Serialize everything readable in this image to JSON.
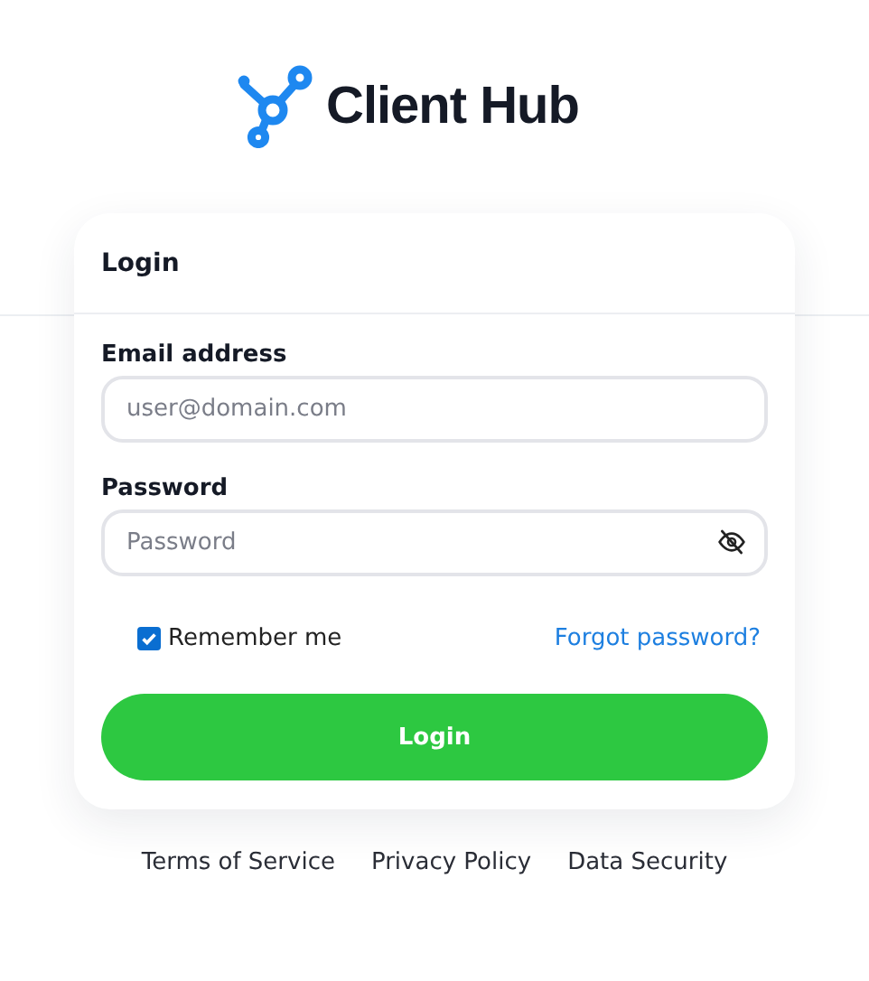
{
  "brand": {
    "name": "Client Hub"
  },
  "card": {
    "title": "Login",
    "fields": [
      {
        "label": "Email address",
        "placeholder": "user@domain.com",
        "kind": "text"
      },
      {
        "label": "Password",
        "placeholder": "Password",
        "kind": "password"
      }
    ],
    "remember": {
      "label": "Remember me",
      "checked": true
    },
    "forgot_link": "Forgot password?",
    "submit": "Login"
  },
  "footer_links": [
    "Terms of Service",
    "Privacy Policy",
    "Data Security"
  ]
}
